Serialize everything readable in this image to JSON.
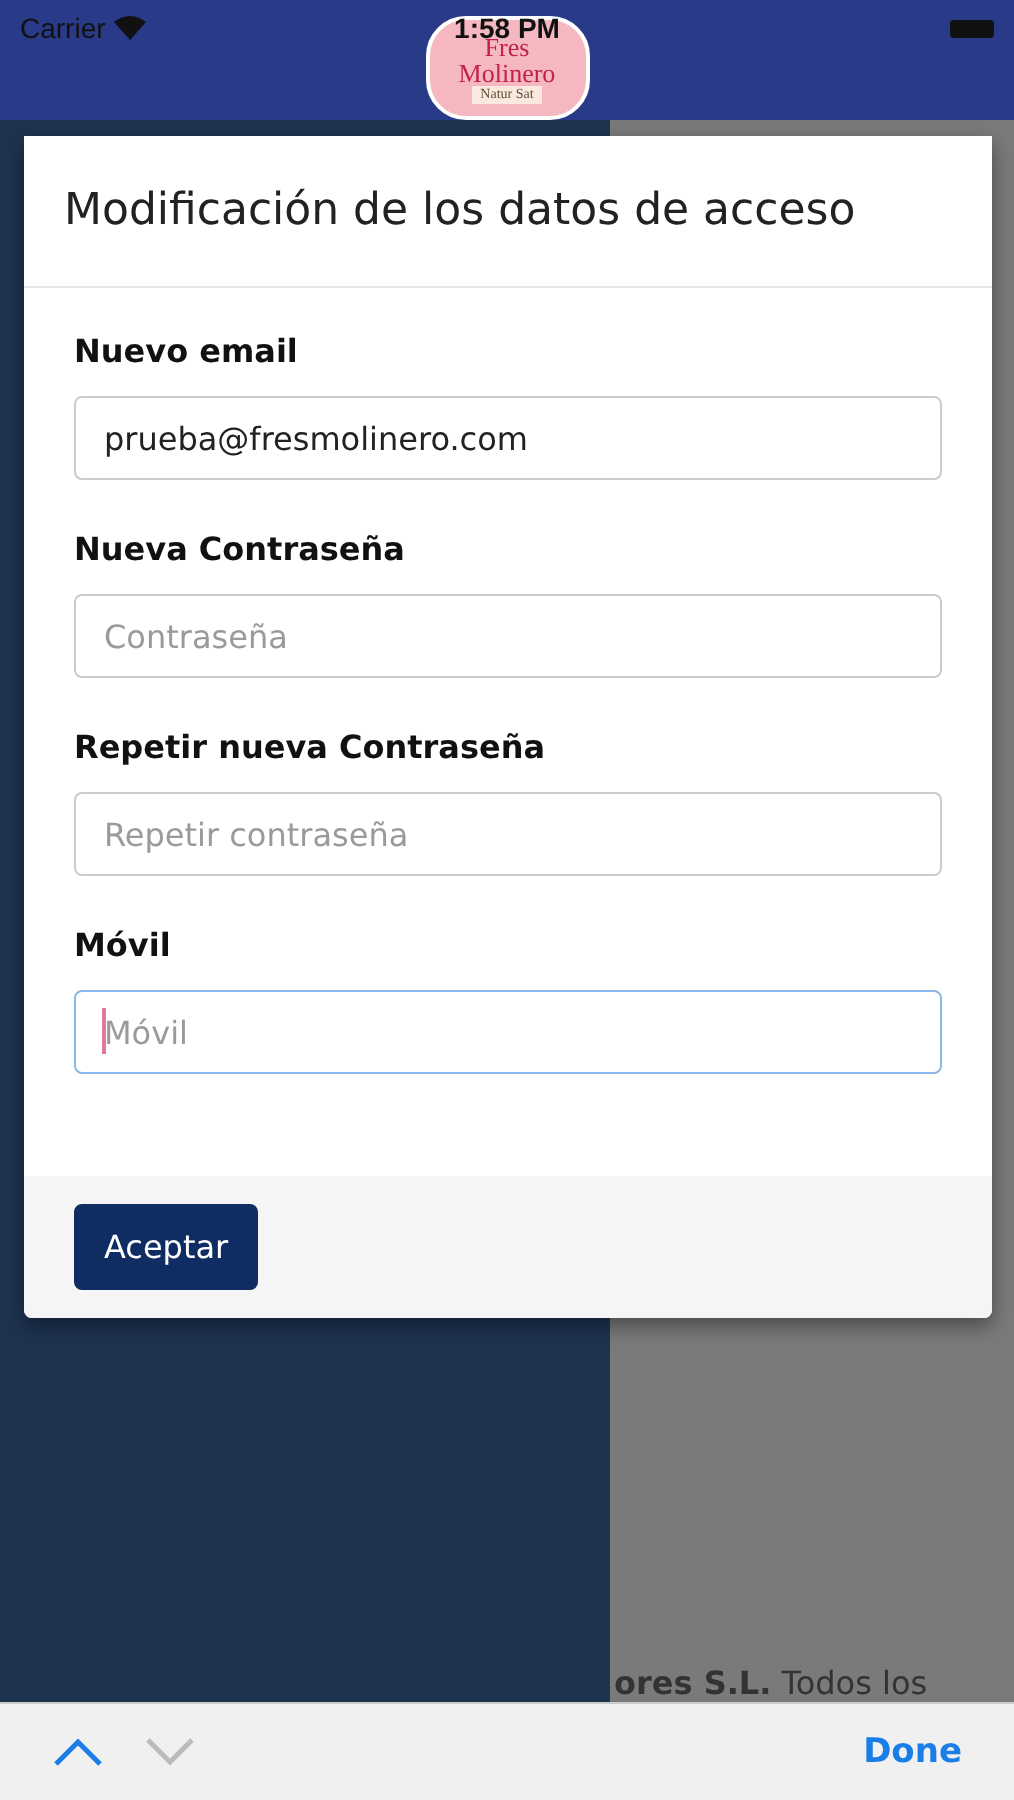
{
  "status_bar": {
    "carrier": "Carrier",
    "time": "1:58 PM"
  },
  "logo": {
    "lines": [
      "Fres",
      "Molinero",
      "Natur Sat"
    ]
  },
  "background": {
    "footer_bold": "ores S.L.",
    "footer_text": "Todos los"
  },
  "modal": {
    "title": "Modificación de los datos de acceso",
    "fields": [
      {
        "label": "Nuevo email",
        "value": "prueba@fresmolinero.com",
        "focused": false
      },
      {
        "label": "Nueva Contraseña",
        "placeholder": "Contraseña",
        "focused": false
      },
      {
        "label": "Repetir nueva Contraseña",
        "placeholder": "Repetir contraseña",
        "focused": false
      },
      {
        "label": "Móvil",
        "placeholder": "Móvil",
        "focused": true
      }
    ],
    "submit": "Aceptar"
  },
  "keyboard_bar": {
    "previous_enabled": true,
    "next_enabled": false,
    "done": "Done"
  }
}
